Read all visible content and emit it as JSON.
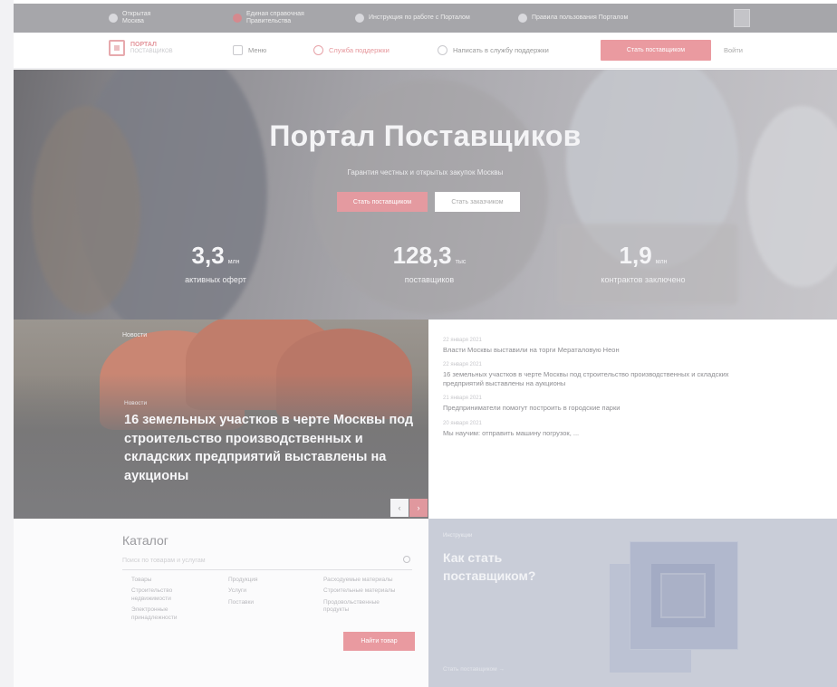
{
  "topbar": {
    "items": [
      {
        "icon": "emblem-icon",
        "label": "Открытая Москва"
      },
      {
        "icon": "phone-icon",
        "label": "Единая справочная Правительства"
      },
      {
        "icon": "info-icon",
        "label": "Инструкция по работе с Порталом"
      },
      {
        "icon": "help-icon",
        "label": "Правила пользования Порталом"
      }
    ],
    "menu_icon": "menu-icon"
  },
  "nav": {
    "logo_line1": "ПОРТАЛ",
    "logo_line2": "ПОСТАВЩИКОВ",
    "items": [
      {
        "label": "Меню",
        "icon": "grid-icon"
      },
      {
        "label": "Служба поддержки",
        "icon": "lifebuoy-icon"
      },
      {
        "label": "Написать в службу поддержки",
        "icon": "chat-icon"
      }
    ],
    "cta_label": "Стать поставщиком",
    "login_label": "Войти"
  },
  "hero": {
    "title": "Портал Поставщиков",
    "subtitle": "Гарантия честных и открытых закупок Москвы",
    "btn_primary": "Стать поставщиком",
    "btn_secondary": "Стать заказчиком",
    "stats": [
      {
        "value": "3,3",
        "unit": "млн",
        "label": "активных оферт"
      },
      {
        "value": "128,3",
        "unit": "тыс",
        "label": "поставщиков"
      },
      {
        "value": "1,9",
        "unit": "млн",
        "label": "контрактов заключено"
      }
    ]
  },
  "featured_news": {
    "top_tag": "Новости",
    "category": "Новости",
    "headline": "16 земельных участков в черте Москвы под строительство производственных и складских предприятий выставлены на аукционы",
    "prev_label": "‹",
    "next_label": "›"
  },
  "news_list": [
    {
      "date": "22 января 2021",
      "text": "Власти Москвы выставили на торги Мераталовую Неон"
    },
    {
      "date": "22 января 2021",
      "text": "16 земельных участков в черте Москвы под строительство производственных и складских предприятий выставлены на аукционы"
    },
    {
      "date": "21 января 2021",
      "text": "Предприниматели помогут построить в городские парки"
    },
    {
      "date": "20 января 2021",
      "text": "Мы научим: отправить машину погрузок, ..."
    }
  ],
  "catalog": {
    "title": "Каталог",
    "search_placeholder": "Поиск по товарам и услугам",
    "columns": [
      [
        "Товары",
        "Строительство недвижимости",
        "Электронные принадлежности"
      ],
      [
        "Продукция",
        "Услуги",
        "Поставки"
      ],
      [
        "Расходуемые материалы",
        "Строительные материалы",
        "Продовольственные продукты"
      ]
    ],
    "button_label": "Найти товар"
  },
  "become": {
    "tag": "Инструкции",
    "title": "Как стать поставщиком?",
    "link": "Стать поставщиком →"
  },
  "colors": {
    "accent": "#e99aa0",
    "topbar": "#a6a6aa",
    "become_bg": "#c9cdd8"
  }
}
